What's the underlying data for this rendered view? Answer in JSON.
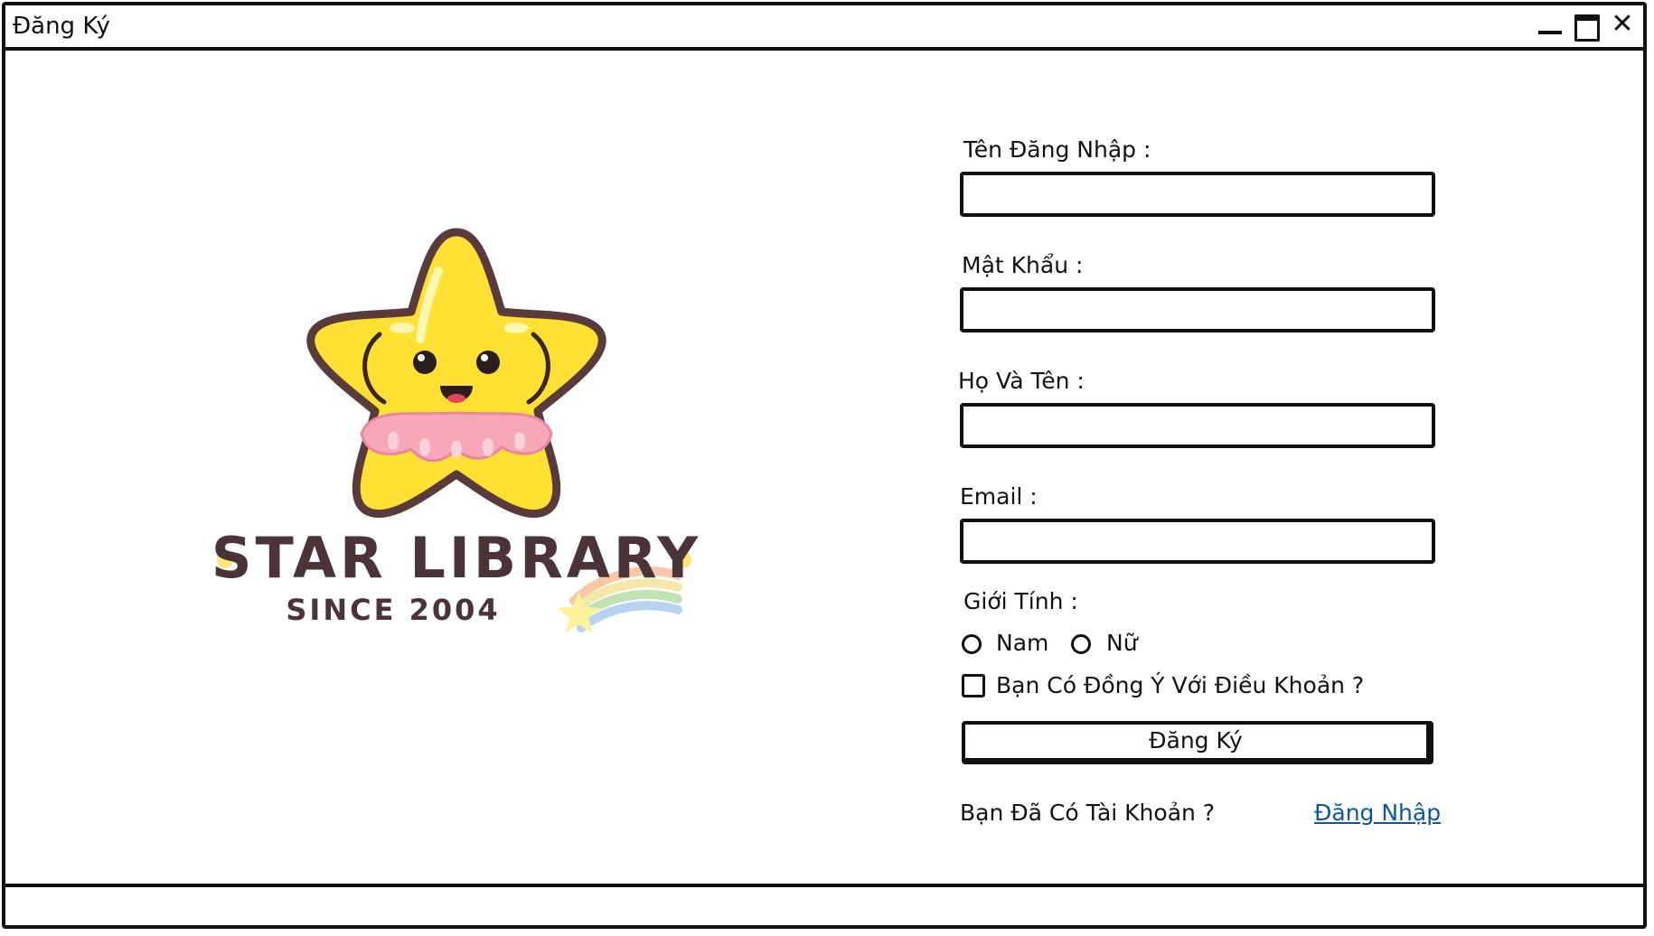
{
  "window": {
    "title": "Đăng Ký"
  },
  "logo": {
    "line1": "STAR LIBRARY",
    "line2": "SINCE 2004"
  },
  "form": {
    "username_label": "Tên Đăng Nhập :",
    "password_label": "Mật Khẩu :",
    "fullname_label": "Họ Và Tên :",
    "email_label": "Email :",
    "gender_label": "Giới Tính :",
    "gender_options": [
      "Nam",
      "Nữ"
    ],
    "terms_label": "Bạn Có Đồng Ý Với Điều Khoản ?",
    "submit_label": "Đăng Ký",
    "have_account_text": "Bạn Đã Có Tài Khoản ?",
    "login_link": "Đăng Nhập"
  },
  "colors": {
    "star_yellow": "#ffe033",
    "star_outline": "#5a3b3b",
    "tutu_pink": "#f6a8b8",
    "link_blue": "#0b57a8"
  }
}
